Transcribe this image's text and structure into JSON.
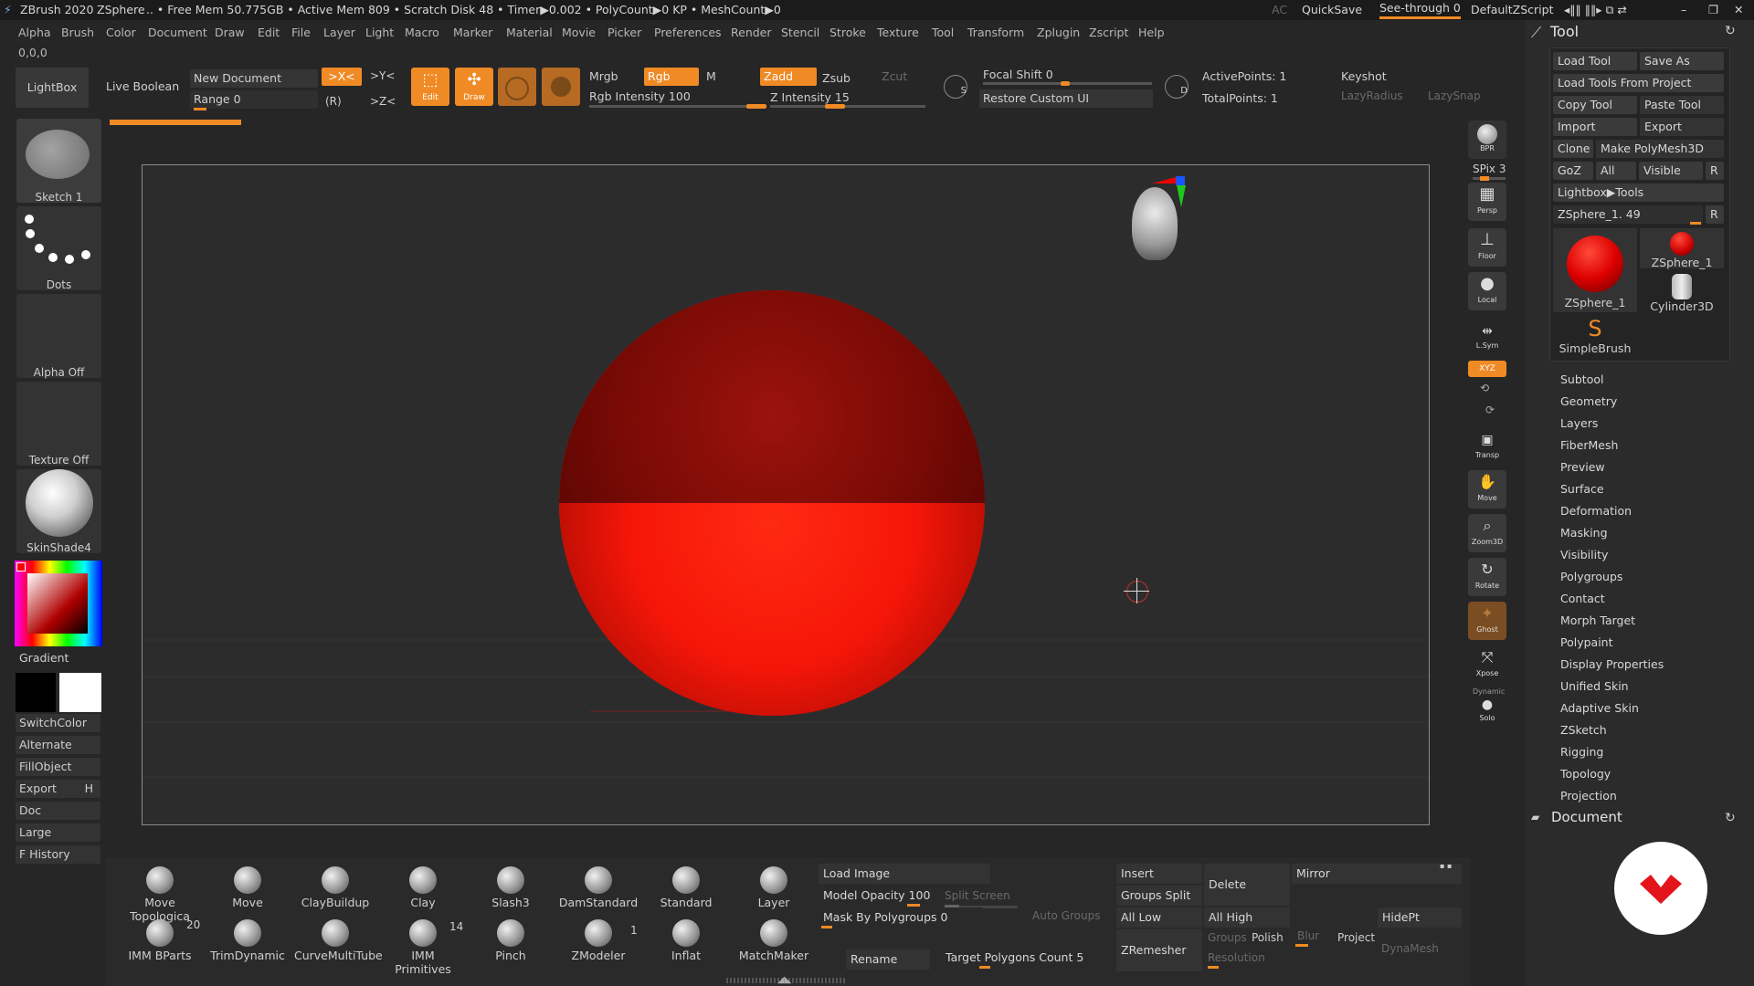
{
  "title_bar": {
    "app": "ZBrush 2020",
    "tool": "ZSphere",
    "stats": ".. • Free Mem 50.775GB • Active Mem 809 • Scratch Disk 48 • Timer▶0.002 • PolyCount▶0 KP • MeshCount▶0",
    "ac": "AC",
    "quicksave": "QuickSave",
    "see_through": "See-through  0",
    "script": "DefaultZScript"
  },
  "menu": [
    "Alpha",
    "Brush",
    "Color",
    "Document",
    "Draw",
    "Edit",
    "File",
    "Layer",
    "Light",
    "Macro",
    "Marker",
    "Material",
    "Movie",
    "Picker",
    "Preferences",
    "Render",
    "Stencil",
    "Stroke",
    "Texture",
    "Tool",
    "Transform",
    "Zplugin",
    "Zscript",
    "Help"
  ],
  "coords": "0,0,0",
  "top": {
    "lightbox": "LightBox",
    "live_boolean": "Live Boolean",
    "new_document": "New Document",
    "range": "Range 0",
    "sym_x": ">X<",
    "sym_y": ">Y<",
    "sym_z": ">Z<",
    "sym_r": "(R)",
    "edit": "Edit",
    "draw": "Draw",
    "mrgb": "Mrgb",
    "rgb": "Rgb",
    "m": "M",
    "rgb_intensity": "Rgb Intensity 100",
    "zadd": "Zadd",
    "zsub": "Zsub",
    "zcut": "Zcut",
    "z_intensity": "Z Intensity 15",
    "focal_shift": "Focal Shift 0",
    "restore_ui": "Restore Custom UI",
    "active_points": "ActivePoints: 1",
    "total_points": "TotalPoints: 1",
    "keyshot": "Keyshot",
    "lazy_radius": "LazyRadius",
    "lazy_snap": "LazySnap",
    "s_label": "S",
    "d_label": "D"
  },
  "left": {
    "thumbs": [
      "Sketch 1",
      "Dots",
      "Alpha Off",
      "Texture Off",
      "SkinShade4"
    ],
    "gradient": "Gradient",
    "switch_color": "SwitchColor",
    "alternate": "Alternate",
    "fill_object": "FillObject",
    "export": "Export",
    "export_key": "H",
    "doc": "Doc",
    "large": "Large",
    "history": "F History"
  },
  "shelf": {
    "bpr": "BPR",
    "spix": "SPix 3",
    "persp": "Persp",
    "floor": "Floor",
    "local": "Local",
    "lsym": "L.Sym",
    "xyz": "XYZ",
    "transp": "Transp",
    "move": "Move",
    "zoom3d": "Zoom3D",
    "rotate": "Rotate",
    "ghost": "Ghost",
    "xpose": "Xpose",
    "dynamic": "Dynamic",
    "solo": "Solo"
  },
  "tool_panel": {
    "title": "Tool",
    "load_tool": "Load Tool",
    "save_as": "Save As",
    "load_from_project": "Load Tools From Project",
    "copy_tool": "Copy Tool",
    "paste_tool": "Paste Tool",
    "import": "Import",
    "export": "Export",
    "clone": "Clone",
    "make_polymesh": "Make PolyMesh3D",
    "goz": "GoZ",
    "all": "All",
    "visible": "Visible",
    "r": "R",
    "lightbox_tools": "Lightbox▶Tools",
    "current": "ZSphere_1. 49",
    "tools": [
      "ZSphere_1",
      "ZSphere_1",
      "Cylinder3D",
      "SimpleBrush"
    ],
    "sections": [
      "Subtool",
      "Geometry",
      "Layers",
      "FiberMesh",
      "Preview",
      "Surface",
      "Deformation",
      "Masking",
      "Visibility",
      "Polygroups",
      "Contact",
      "Morph Target",
      "Polypaint",
      "Display Properties",
      "Unified Skin",
      "Adaptive Skin",
      "ZSketch",
      "Rigging",
      "Topology",
      "Projection"
    ],
    "document": "Document"
  },
  "brushes_row1": [
    "Move Topologica",
    "Move",
    "ClayBuildup",
    "Clay",
    "Slash3",
    "DamStandard",
    "Standard",
    "Layer"
  ],
  "brushes_row2": [
    "IMM BParts",
    "TrimDynamic",
    "CurveMultiTube",
    "IMM Primitives",
    "Pinch",
    "ZModeler",
    "Inflat",
    "MatchMaker"
  ],
  "brush_counts": {
    "imm_bparts": "20",
    "imm_primitives": "14",
    "zmodeler": "1"
  },
  "bottom": {
    "load_image": "Load Image",
    "model_opacity": "Model Opacity 100",
    "split_screen": "Split Screen",
    "mask_by_polygroups": "Mask By Polygroups 0",
    "auto_groups": "Auto Groups",
    "rename": "Rename",
    "target_polygons": "Target Polygons Count 5",
    "insert": "Insert",
    "delete": "Delete",
    "mirror": "Mirror",
    "groups_split": "Groups Split",
    "all_low": "All Low",
    "all_high": "All High",
    "hide_pt": "HidePt",
    "zremesher": "ZRemesher",
    "groups": "Groups",
    "polish": "Polish",
    "blur": "Blur",
    "project": "Project",
    "resolution": "Resolution",
    "dynamesh": "DynaMesh"
  },
  "colors": {
    "accent": "#f08a24",
    "sphere_top": "#8f0c06",
    "sphere_bottom": "#ff1d0a"
  }
}
